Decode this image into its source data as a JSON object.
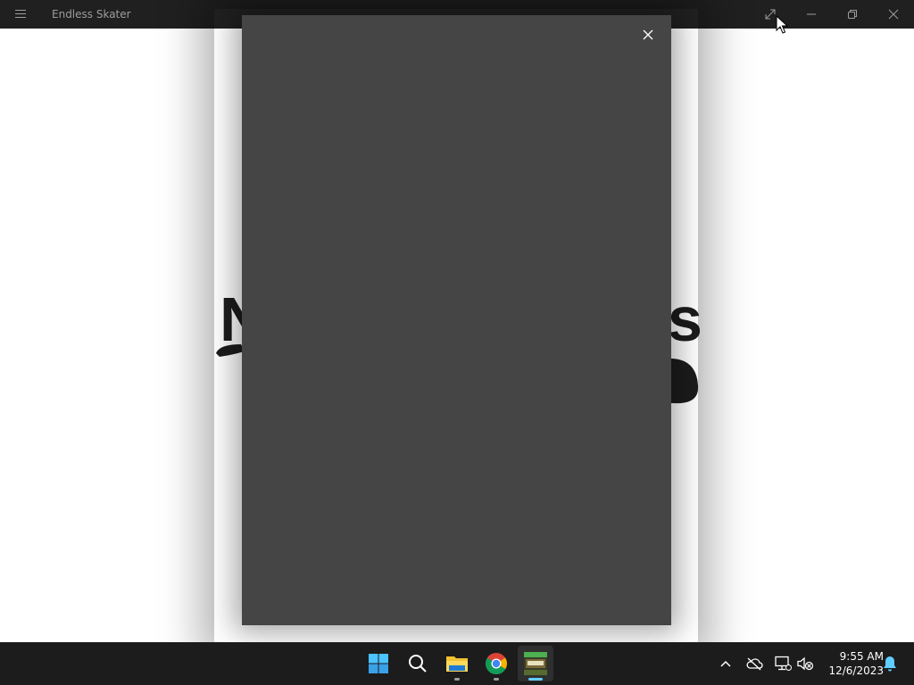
{
  "window": {
    "title": "Endless Skater",
    "buttons": [
      "fullscreen-icon",
      "minimize-icon",
      "restore-icon",
      "close-icon"
    ]
  },
  "background": {
    "text_left": "N",
    "text_right": "s"
  },
  "overlay": {
    "close_icon": "close-icon",
    "background_color": "#454545"
  },
  "taskbar": {
    "apps": [
      "windows-start-icon",
      "search-icon",
      "file-explorer-icon",
      "chrome-icon",
      "endless-skater-app-icon"
    ],
    "tray_icons": [
      "chevron-up-icon",
      "onedrive-offline-icon",
      "network-icon",
      "volume-muted-icon",
      "notification-bell-icon"
    ],
    "time": "9:55 AM",
    "date": "12/6/2023",
    "accent_color": "#60cdff"
  }
}
